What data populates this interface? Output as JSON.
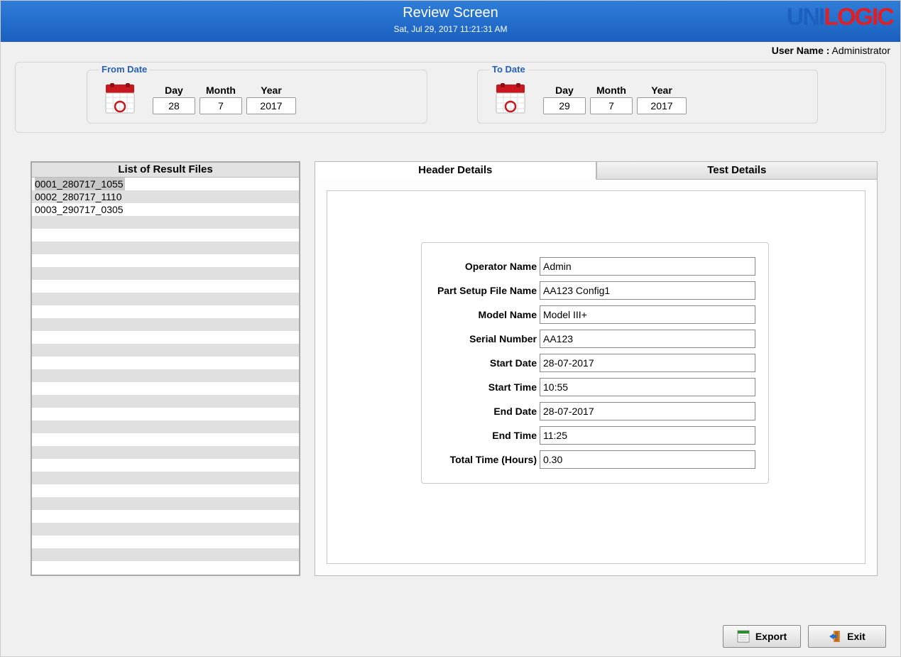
{
  "header": {
    "title": "Review Screen",
    "timestamp": "Sat, Jul 29, 2017 11:21:31 AM",
    "logo_part1": "UNI",
    "logo_part2": "LOGIC"
  },
  "userbar": {
    "label": "User Name :",
    "value": "Administrator"
  },
  "date": {
    "from_legend": "From Date",
    "to_legend": "To Date",
    "day_label": "Day",
    "month_label": "Month",
    "year_label": "Year",
    "from": {
      "day": "28",
      "month": "7",
      "year": "2017"
    },
    "to": {
      "day": "29",
      "month": "7",
      "year": "2017"
    }
  },
  "list": {
    "header": "List of Result Files",
    "items": [
      "0001_280717_1055",
      "0002_280717_1110",
      "0003_290717_0305"
    ],
    "selected_index": 0,
    "total_rows_visible": 30
  },
  "tabs": {
    "header": "Header Details",
    "test": "Test Details",
    "active": "header"
  },
  "form": {
    "operator_name": {
      "label": "Operator Name",
      "value": "Admin"
    },
    "part_setup_file_name": {
      "label": "Part Setup File Name",
      "value": "AA123 Config1"
    },
    "model_name": {
      "label": "Model Name",
      "value": "Model III+"
    },
    "serial_number": {
      "label": "Serial Number",
      "value": "AA123"
    },
    "start_date": {
      "label": "Start Date",
      "value": "28-07-2017"
    },
    "start_time": {
      "label": "Start Time",
      "value": "10:55"
    },
    "end_date": {
      "label": "End Date",
      "value": "28-07-2017"
    },
    "end_time": {
      "label": "End Time",
      "value": "11:25"
    },
    "total_time": {
      "label": "Total Time (Hours)",
      "value": "0.30"
    }
  },
  "buttons": {
    "export": "Export",
    "exit": "Exit"
  }
}
